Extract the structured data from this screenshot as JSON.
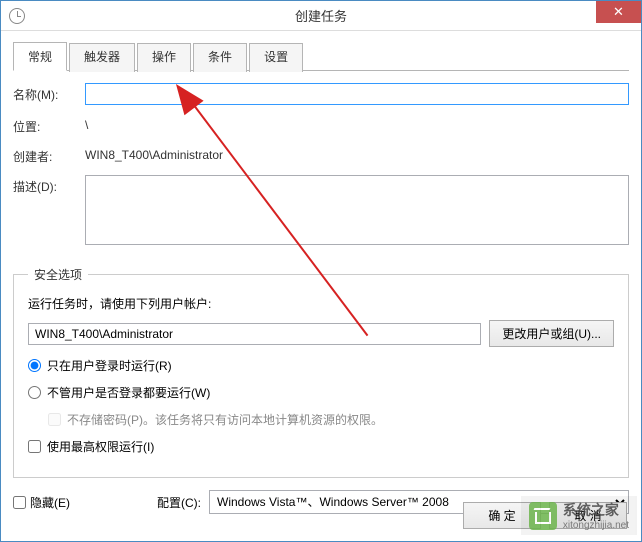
{
  "window": {
    "title": "创建任务",
    "close": "✕"
  },
  "tabs": [
    {
      "label": "常规",
      "active": true
    },
    {
      "label": "触发器",
      "active": false
    },
    {
      "label": "操作",
      "active": false
    },
    {
      "label": "条件",
      "active": false
    },
    {
      "label": "设置",
      "active": false
    }
  ],
  "general": {
    "name_label": "名称(M):",
    "name_value": "",
    "location_label": "位置:",
    "location_value": "\\",
    "creator_label": "创建者:",
    "creator_value": "WIN8_T400\\Administrator",
    "description_label": "描述(D):",
    "description_value": ""
  },
  "security": {
    "legend": "安全选项",
    "run_as_label": "运行任务时，请使用下列用户帐户:",
    "account": "WIN8_T400\\Administrator",
    "change_user_btn": "更改用户或组(U)...",
    "radio_logged_on": "只在用户登录时运行(R)",
    "radio_any": "不管用户是否登录都要运行(W)",
    "no_store_pwd": "不存储密码(P)。该任务将只有访问本地计算机资源的权限。",
    "highest_priv": "使用最高权限运行(I)"
  },
  "bottom": {
    "hidden_label": "隐藏(E)",
    "config_label": "配置(C):",
    "config_value": "Windows Vista™、Windows Server™ 2008"
  },
  "footer": {
    "ok": "确 定",
    "cancel": "取 消"
  },
  "watermark": {
    "name": "系统之家",
    "url": "xitongzhijia.net"
  }
}
